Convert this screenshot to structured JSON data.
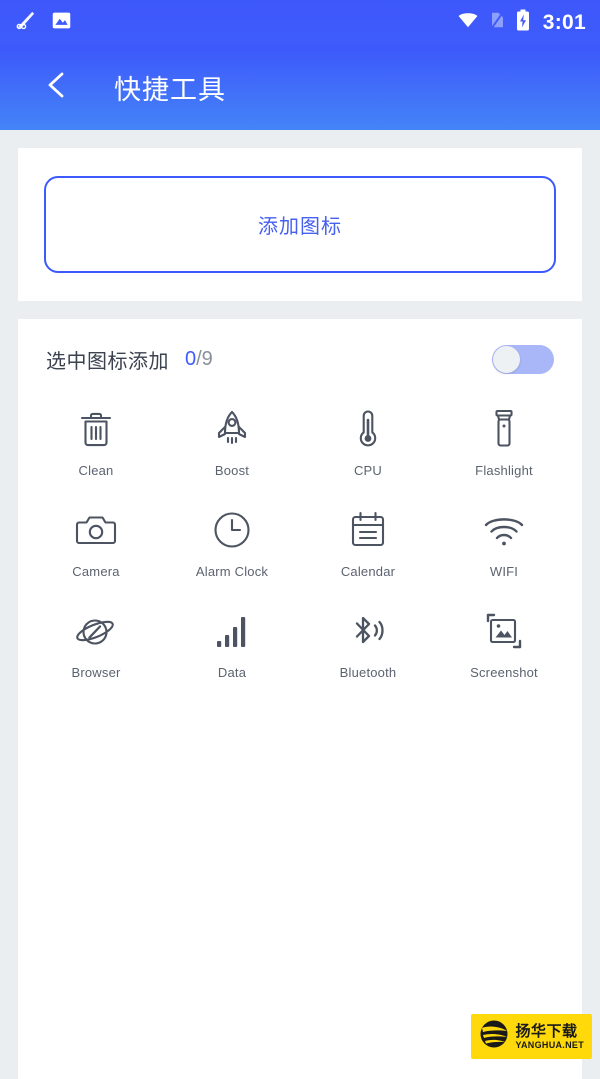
{
  "status_bar": {
    "notifications": [
      "screenshot-tool-icon",
      "gallery-icon"
    ],
    "wifi": "wifi-icon",
    "sim": "no-sim-icon",
    "battery": "battery-charging-icon",
    "clock": "3:01"
  },
  "app_bar": {
    "back": "back-chevron-icon",
    "title": "快捷工具"
  },
  "add_card": {
    "label": "添加图标"
  },
  "select_row": {
    "label": "选中图标添加",
    "count_current": "0",
    "count_total": "/9",
    "toggle_state": "off"
  },
  "colors": {
    "accent_blue": "#3d5afe",
    "header_top": "#3d57fb",
    "header_bottom": "#4484f7",
    "page_bg": "#eaeef1",
    "card_bg": "#ffffff",
    "icon_gray": "#4c5361",
    "label_gray": "#5b636f",
    "toggle_track": "#a9b6f7",
    "watermark_yellow": "#ffd90a"
  },
  "tools": [
    {
      "label": "Clean",
      "icon": "trash-icon"
    },
    {
      "label": "Boost",
      "icon": "rocket-icon"
    },
    {
      "label": "CPU",
      "icon": "thermometer-icon"
    },
    {
      "label": "Flashlight",
      "icon": "flashlight-icon"
    },
    {
      "label": "Camera",
      "icon": "camera-icon"
    },
    {
      "label": "Alarm Clock",
      "icon": "clock-icon"
    },
    {
      "label": "Calendar",
      "icon": "calendar-icon"
    },
    {
      "label": "WIFI",
      "icon": "wifi-icon"
    },
    {
      "label": "Browser",
      "icon": "planet-icon"
    },
    {
      "label": "Data",
      "icon": "signal-bars-icon"
    },
    {
      "label": "Bluetooth",
      "icon": "bluetooth-icon"
    },
    {
      "label": "Screenshot",
      "icon": "screenshot-icon"
    }
  ],
  "watermark": {
    "cn": "扬华下载",
    "en": "YANGHUA.NET"
  }
}
